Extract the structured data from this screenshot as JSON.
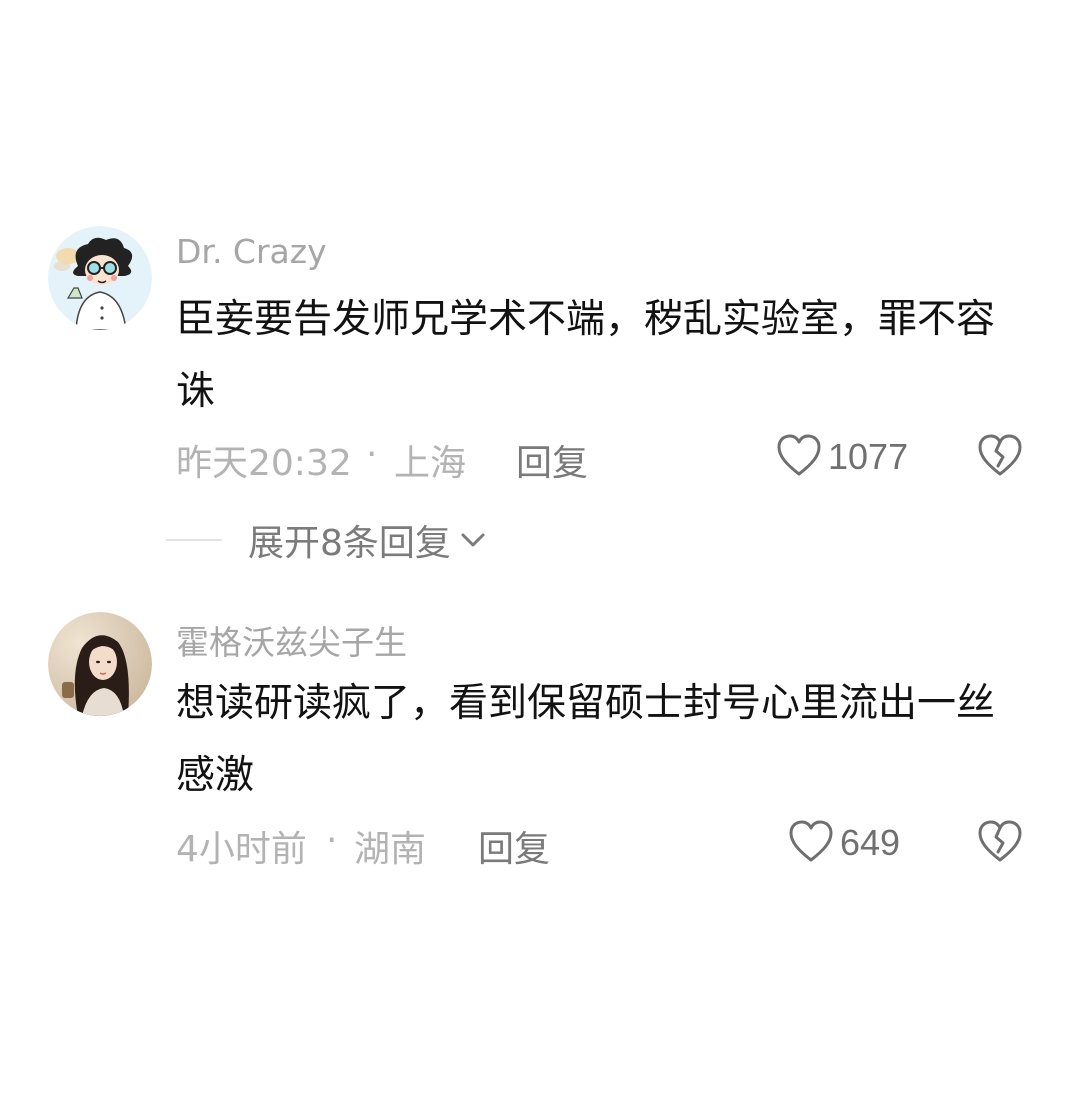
{
  "comments": [
    {
      "username": "Dr. Crazy",
      "text": "臣妾要告发师兄学术不端，秽乱实验室，罪不容诛",
      "time": "昨天20:32",
      "separator": "·",
      "location": "上海",
      "reply_label": "回复",
      "likes": "1077",
      "avatar_icon": "cartoon-scientist-avatar"
    },
    {
      "username": "霍格沃兹尖子生",
      "text": "想读研读疯了，看到保留硕士封号心里流出一丝感激",
      "time": "4小时前",
      "separator": "·",
      "location": "湖南",
      "reply_label": "回复",
      "likes": "649",
      "avatar_icon": "girl-photo-avatar"
    }
  ],
  "expand_replies": {
    "label": "展开8条回复",
    "icon": "chevron-down-icon"
  },
  "colors": {
    "background": "#ffffff",
    "username": "#a6a6a6",
    "body_text": "#121212",
    "meta_text": "#b3b3b3",
    "action_text": "#7a7a7a"
  }
}
